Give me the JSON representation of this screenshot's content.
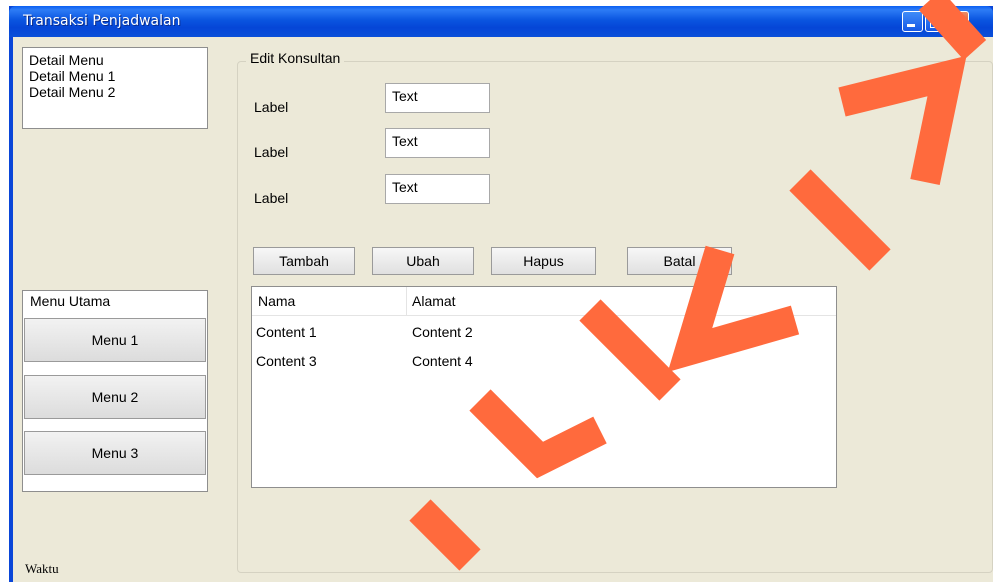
{
  "window": {
    "title": "Transaksi Penjadwalan"
  },
  "detail_menu": {
    "items": [
      "Detail Menu",
      "Detail Menu 1",
      "Detail Menu 2"
    ]
  },
  "main_menu": {
    "title": "Menu Utama",
    "buttons": [
      "Menu 1",
      "Menu 2",
      "Menu 3"
    ]
  },
  "status": {
    "waktu_label": "Waktu"
  },
  "form": {
    "legend": "Edit Konsultan",
    "fields": [
      {
        "label": "Label",
        "value": "Text"
      },
      {
        "label": "Label",
        "value": "Text"
      },
      {
        "label": "Label",
        "value": "Text"
      }
    ]
  },
  "actions": {
    "tambah": "Tambah",
    "ubah": "Ubah",
    "hapus": "Hapus",
    "batal": "Batal"
  },
  "table": {
    "columns": [
      "Nama",
      "Alamat"
    ],
    "rows": [
      [
        "Content 1",
        "Content 2"
      ],
      [
        "Content 3",
        "Content 4"
      ]
    ]
  },
  "watermark": {
    "text": "SURABAYA",
    "color": "#ff6a3d"
  },
  "colors": {
    "titlebar": "#0a55e0",
    "client_bg": "#ece9d8",
    "close_button": "#d2471d"
  }
}
